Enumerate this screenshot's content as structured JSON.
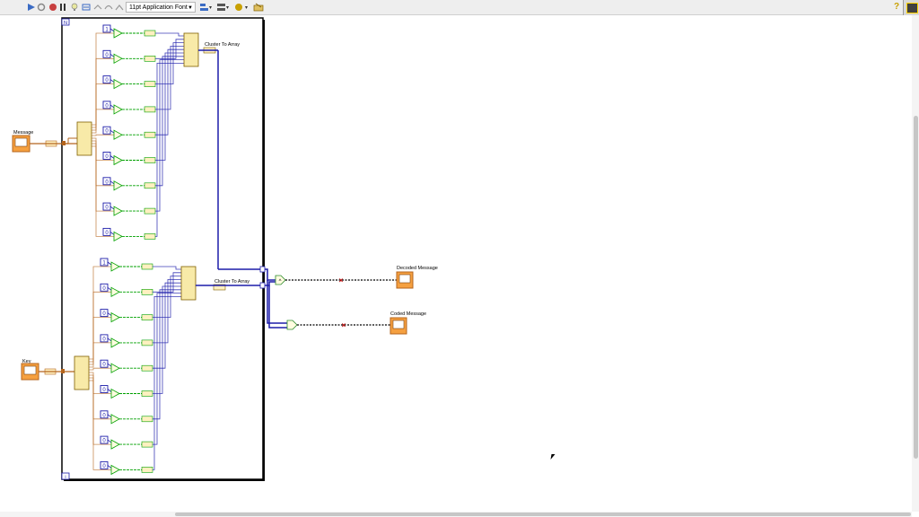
{
  "toolbar": {
    "font_select": "11pt Application Font",
    "icons": [
      "run-arrow-icon",
      "run-continuous-icon",
      "abort-icon",
      "pause-icon",
      "highlight-execution-icon",
      "retain-wire-values-icon",
      "step-into-icon",
      "step-over-icon",
      "step-out-icon",
      "text-settings-icon",
      "align-icon",
      "distribute-icon",
      "reorder-icon",
      "cleanup-icon",
      "help-icon"
    ]
  },
  "diagram": {
    "loop_index_label": "N",
    "loop_iter_label": "i",
    "terminals": {
      "message": "Message",
      "key": "Key",
      "decoded": "Decoded Message",
      "coded": "Coded Message"
    },
    "nodes": {
      "cluster_to_array_1": "Cluster To Array",
      "cluster_to_array_2": "Cluster To Array",
      "constant_value": "0",
      "top_first_constant": "1",
      "bottom_first_constant": "1",
      "xor_symbol": "^"
    },
    "colors": {
      "bool_wire": "#00a000",
      "cluster_wire": "#b5651d",
      "array_wire": "#1d1daa",
      "frame": "#000000",
      "control_orange": "#f5a040"
    }
  }
}
